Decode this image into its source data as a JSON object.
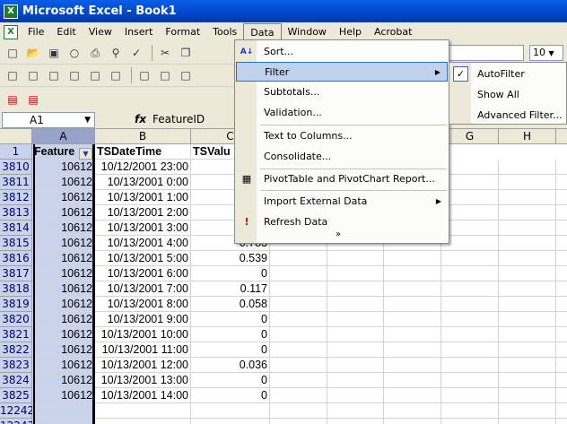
{
  "window": {
    "title": "Microsoft Excel - Book1"
  },
  "menubar": [
    "File",
    "Edit",
    "View",
    "Insert",
    "Format",
    "Tools",
    "Data",
    "Window",
    "Help",
    "Acrobat"
  ],
  "toolbar": {
    "font_size": "10"
  },
  "formula": {
    "cell_ref": "A1",
    "fx": "fx",
    "content": "FeatureID"
  },
  "grid": {
    "columns": [
      "A",
      "B",
      "C",
      "G",
      "H"
    ],
    "header_row": {
      "row": "1",
      "a": "Feature",
      "b": "TSDateTime",
      "c": "TSValu"
    },
    "rows": [
      {
        "n": "3810",
        "a": "10612",
        "b": "10/12/2001 23:00",
        "c": ""
      },
      {
        "n": "3811",
        "a": "10612",
        "b": "10/13/2001 0:00",
        "c": ""
      },
      {
        "n": "3812",
        "a": "10612",
        "b": "10/13/2001 1:00",
        "c": ""
      },
      {
        "n": "3813",
        "a": "10612",
        "b": "10/13/2001 2:00",
        "c": ""
      },
      {
        "n": "3814",
        "a": "10612",
        "b": "10/13/2001 3:00",
        "c": ""
      },
      {
        "n": "3815",
        "a": "10612",
        "b": "10/13/2001 4:00",
        "c": "0.783"
      },
      {
        "n": "3816",
        "a": "10612",
        "b": "10/13/2001 5:00",
        "c": "0.539"
      },
      {
        "n": "3817",
        "a": "10612",
        "b": "10/13/2001 6:00",
        "c": "0"
      },
      {
        "n": "3818",
        "a": "10612",
        "b": "10/13/2001 7:00",
        "c": "0.117"
      },
      {
        "n": "3819",
        "a": "10612",
        "b": "10/13/2001 8:00",
        "c": "0.058"
      },
      {
        "n": "3820",
        "a": "10612",
        "b": "10/13/2001 9:00",
        "c": "0"
      },
      {
        "n": "3821",
        "a": "10612",
        "b": "10/13/2001 10:00",
        "c": "0"
      },
      {
        "n": "3822",
        "a": "10612",
        "b": "10/13/2001 11:00",
        "c": "0"
      },
      {
        "n": "3823",
        "a": "10612",
        "b": "10/13/2001 12:00",
        "c": "0.036"
      },
      {
        "n": "3824",
        "a": "10612",
        "b": "10/13/2001 13:00",
        "c": "0"
      },
      {
        "n": "3825",
        "a": "10612",
        "b": "10/13/2001 14:00",
        "c": "0"
      },
      {
        "n": "12242",
        "a": "",
        "b": "",
        "c": ""
      },
      {
        "n": "12243",
        "a": "",
        "b": "",
        "c": ""
      }
    ]
  },
  "data_menu": {
    "items": [
      {
        "label": "Sort...",
        "icon": "sort-az-icon"
      },
      {
        "label": "Filter",
        "icon": ""
      },
      {
        "label": "Subtotals...",
        "icon": ""
      },
      {
        "label": "Validation...",
        "icon": ""
      },
      {
        "label": "Text to Columns...",
        "icon": ""
      },
      {
        "label": "Consolidate...",
        "icon": ""
      },
      {
        "label": "PivotTable and PivotChart Report...",
        "icon": "pivot-icon"
      },
      {
        "label": "Import External Data",
        "icon": ""
      },
      {
        "label": "Refresh Data",
        "icon": "refresh-icon"
      }
    ]
  },
  "filter_submenu": {
    "items": [
      {
        "label": "AutoFilter",
        "checked": true
      },
      {
        "label": "Show All",
        "checked": false
      },
      {
        "label": "Advanced Filter...",
        "checked": false
      }
    ]
  }
}
